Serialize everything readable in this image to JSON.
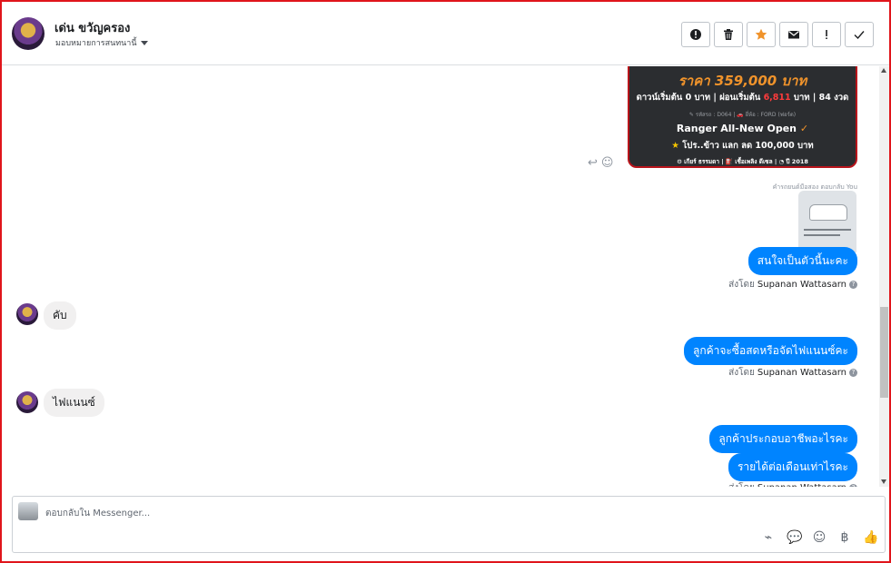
{
  "header": {
    "name": "เด่น ขวัญครอง",
    "assign_label": "มอบหมายการสนทนานี้",
    "buttons": [
      {
        "icon": "alert-circle-icon",
        "glyph": "!"
      },
      {
        "icon": "trash-icon",
        "glyph": "🗑"
      },
      {
        "icon": "star-icon",
        "glyph": "★"
      },
      {
        "icon": "envelope-icon",
        "glyph": "✉"
      },
      {
        "icon": "exclamation-icon",
        "glyph": "!"
      },
      {
        "icon": "check-icon",
        "glyph": "✓"
      }
    ]
  },
  "card": {
    "price": "ราคา 359,000 บาท",
    "terms_prefix": "ดาวน์เริ่มต้น 0 บาท | ผ่อนเริ่มต้น ",
    "terms_monthly": "6,811",
    "terms_suffix": " บาท | 84 งวด",
    "model_line": "✎ รหัสรถ : D064 | 🚗 ยี่ห้อ : FORD (ฟอร์ด)",
    "title": "Ranger All-New Open",
    "promo": "โปร..ข้าว แลก ลด 100,000 บาท",
    "specs": "⚙ เกียร์ ธรรมดา  |  ⛽ เชื้อเพลิง ดีเซล  |  ◔ ปี 2018"
  },
  "reply_note": "คำรถยนต์มือสอง ตอบกลับ You",
  "messages": {
    "m1": "สนใจเป็นตัวนี้นะคะ",
    "m2": "คับ",
    "m3": "ลูกค้าจะซื้อสดหรือจัดไฟแนนซ์คะ",
    "m4": "ไฟแนนซ์",
    "m5": "ลูกค้าประกอบอาชีพอะไรคะ",
    "m6": "รายได้ต่อเดือนเท่าไรคะ"
  },
  "sent_by_prefix": "ส่งโดย",
  "sent_by_name": "Supanan Wattasarn",
  "composer": {
    "placeholder": "ตอบกลับใน Messenger..."
  },
  "colors": {
    "accent": "#0084ff",
    "price": "#f0932b",
    "card_border": "#b8141b",
    "frame": "#e0151b"
  }
}
